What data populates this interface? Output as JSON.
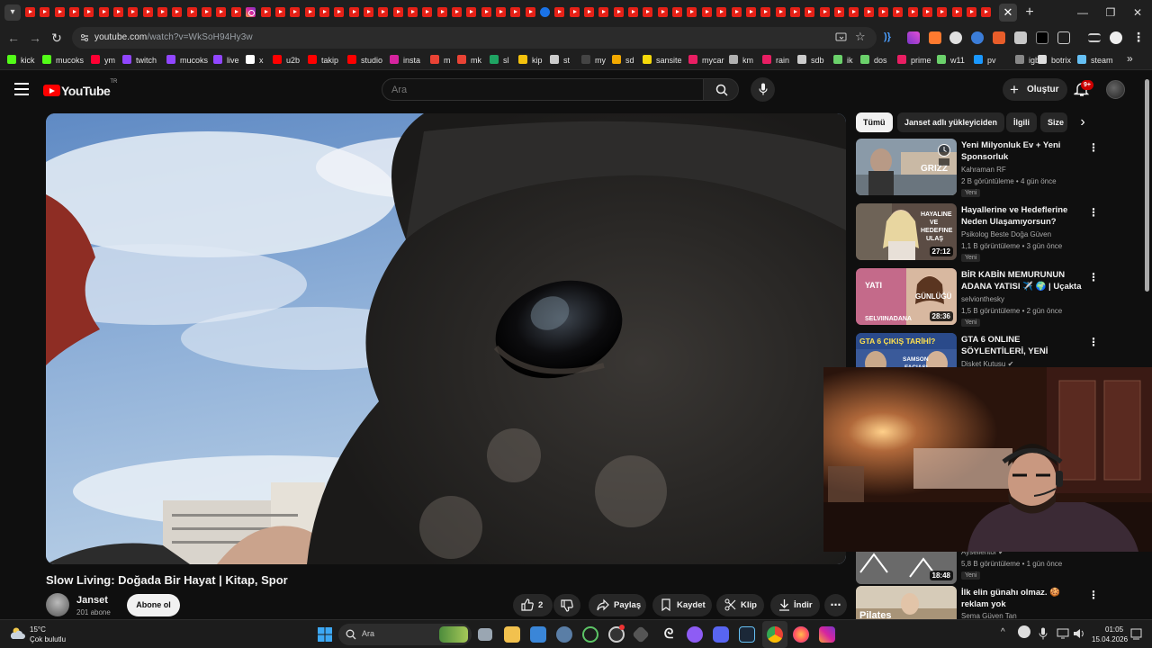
{
  "browser": {
    "url_host": "youtube.com",
    "url_path": "/watch?v=WkSoH94Hy3w",
    "tab_close": "✕",
    "new_tab": "+",
    "window_controls": {
      "minimize": "—",
      "restore": "❐",
      "close": "✕"
    }
  },
  "bookmarks": [
    {
      "label": "kick",
      "icon": "kick-icon",
      "color": "#53fc18"
    },
    {
      "label": "mucoks",
      "icon": "kick-icon",
      "color": "#53fc18"
    },
    {
      "label": "ym",
      "icon": "youtube-music-icon",
      "color": "#ff0033"
    },
    {
      "label": "twitch",
      "icon": "twitch-icon",
      "color": "#9146ff"
    },
    {
      "label": "mucoks",
      "icon": "twitch-icon",
      "color": "#9146ff"
    },
    {
      "label": "live",
      "icon": "twitch-icon",
      "color": "#9146ff"
    },
    {
      "label": "x",
      "icon": "x-icon",
      "color": "#ffffff"
    },
    {
      "label": "u2b",
      "icon": "youtube-icon",
      "color": "#ff0000"
    },
    {
      "label": "takip",
      "icon": "youtube-icon",
      "color": "#ff0000"
    },
    {
      "label": "studio",
      "icon": "youtube-icon",
      "color": "#ff0000"
    },
    {
      "label": "insta",
      "icon": "instagram-icon",
      "color": "#d6249f"
    },
    {
      "label": "m",
      "icon": "gmail-icon",
      "color": "#ea4335"
    },
    {
      "label": "mk",
      "icon": "gmail-icon",
      "color": "#ea4335"
    },
    {
      "label": "sl",
      "icon": "sheet-icon",
      "color": "#1fa463"
    },
    {
      "label": "kip",
      "icon": "note-icon",
      "color": "#f4c20d"
    },
    {
      "label": "st",
      "icon": "github-icon",
      "color": "#cccccc"
    },
    {
      "label": "my",
      "icon": "globe-icon",
      "color": "#444444"
    },
    {
      "label": "sd",
      "icon": "s-icon",
      "color": "#f2a900"
    },
    {
      "label": "sansite",
      "icon": "s-icon",
      "color": "#f5d90a"
    },
    {
      "label": "mycar",
      "icon": "car-icon",
      "color": "#e91e63"
    },
    {
      "label": "km",
      "icon": "k-icon",
      "color": "#b0b0b0"
    },
    {
      "label": "rain",
      "icon": "rain-icon",
      "color": "#e91e63"
    },
    {
      "label": "sdb",
      "icon": "database-icon",
      "color": "#cccccc"
    },
    {
      "label": "ik",
      "icon": "power-icon",
      "color": "#6bd16b"
    },
    {
      "label": "dos",
      "icon": "power-icon",
      "color": "#6bd16b"
    },
    {
      "label": "prime",
      "icon": "prime-icon",
      "color": "#e91e63"
    },
    {
      "label": "w11",
      "icon": "power-icon",
      "color": "#6bd16b"
    },
    {
      "label": "pv",
      "icon": "prime-video-icon",
      "color": "#1a98ff"
    },
    {
      "label": "igb",
      "icon": "ig-icon",
      "color": "#888888"
    },
    {
      "label": "botrix",
      "icon": "botrix-icon",
      "color": "#dddddd"
    },
    {
      "label": "steam",
      "icon": "steam-icon",
      "color": "#66c0f4"
    }
  ],
  "bookmarks_more": "»",
  "youtube": {
    "logo_text": "YouTube",
    "region": "TR",
    "search_placeholder": "Ara",
    "create_label": "Oluştur",
    "notification_count": "9+"
  },
  "video": {
    "title": "Slow Living: Doğada Bir Hayat | Kitap, Spor",
    "channel": "Janset",
    "subscribers": "201 abone",
    "subscribe_label": "Abone ol",
    "like_count": "2",
    "share_label": "Paylaş",
    "save_label": "Kaydet",
    "clip_label": "Klip",
    "download_label": "İndir"
  },
  "chips": [
    "Tümü",
    "Janset adlı yükleyiciden",
    "İlgili",
    "Size"
  ],
  "recommendations": [
    {
      "title": "Yeni Milyonluk Ev + Yeni Sponsorluk",
      "channel": "Kahraman RF",
      "meta": "2 B görüntüleme • 4 gün önce",
      "badge": "Yeni",
      "duration": ""
    },
    {
      "title": "Hayallerine ve Hedeflerine Neden Ulaşamıyorsun?",
      "channel": "Psikolog Beste Doğa Güven",
      "meta": "1,1 B görüntüleme • 3 gün önce",
      "badge": "Yeni",
      "duration": "27:12"
    },
    {
      "title": "BİR KABİN MEMURUNUN ADANA YATISI ✈️ 🌍 | Uçakta ...",
      "channel": "selvionthesky",
      "meta": "1,5 B görüntüleme • 2 gün önce",
      "badge": "Yeni",
      "duration": "28:36"
    },
    {
      "title": "GTA 6 ONLINE SÖYLENTİLERİ, YENİ PLAYSTATION 6 EL ...",
      "channel": "Disket Kutusu",
      "meta": "",
      "badge": "",
      "duration": ""
    },
    {
      "title": "",
      "channel": "Ayseilentof",
      "meta": "5,8 B görüntüleme • 1 gün önce",
      "badge": "Yeni",
      "duration": "18:48"
    },
    {
      "title": "İlk elin günahı olmaz. 🍪 reklam yok",
      "channel": "Sema Güven Tan",
      "meta": "",
      "badge": "",
      "duration": ""
    }
  ],
  "thumb_texts": {
    "t1": "GRIZZ",
    "t2": "HAYALINE VE HEDEFINE ULAŞ",
    "t3a": "YATI",
    "t3b": "GÜNLÜĞÜ",
    "t3c": "SELVIINADANA",
    "t4a": "GTA 6 ÇIKIŞ TARİHİ?",
    "t4b": "SAMSON FACIASI",
    "t6": "Pilates"
  },
  "taskbar": {
    "temperature": "15°C",
    "weather": "Çok bulutlu",
    "search_placeholder": "Ara",
    "time": "01:05",
    "date": "15.04.2026"
  }
}
